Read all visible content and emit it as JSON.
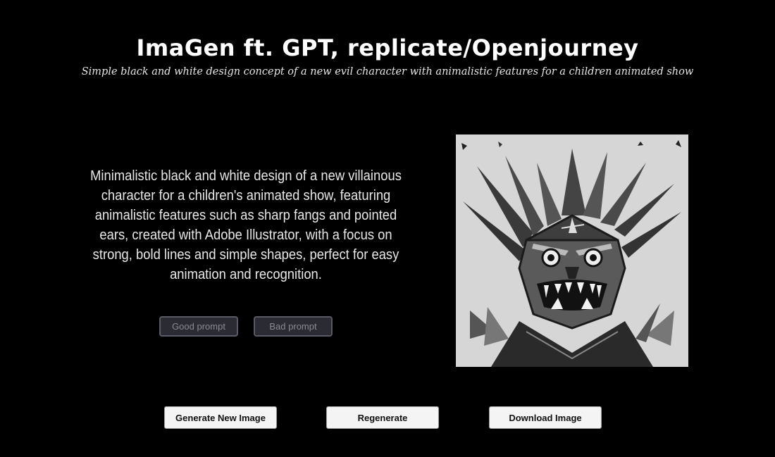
{
  "header": {
    "title": "ImaGen ft. GPT, replicate/Openjourney",
    "subtitle": "Simple black and white design concept of a new evil character with animalistic features for a children animated show"
  },
  "prompt": {
    "text": "Minimalistic black and white design of a new villainous character for a children's animated show, featuring animalistic features such as sharp fangs and pointed ears, created with Adobe Illustrator, with a focus on strong, bold lines and simple shapes, perfect for easy animation and recognition."
  },
  "feedback": {
    "good_label": "Good prompt",
    "bad_label": "Bad prompt"
  },
  "image": {
    "alt": "Generated black and white villain character illustration"
  },
  "actions": {
    "generate_label": "Generate New Image",
    "regenerate_label": "Regenerate",
    "download_label": "Download Image"
  },
  "colors": {
    "background": "#000000",
    "text": "#ffffff",
    "feedback_button_bg": "#2b2b33",
    "action_button_bg": "#f4f4f4"
  }
}
